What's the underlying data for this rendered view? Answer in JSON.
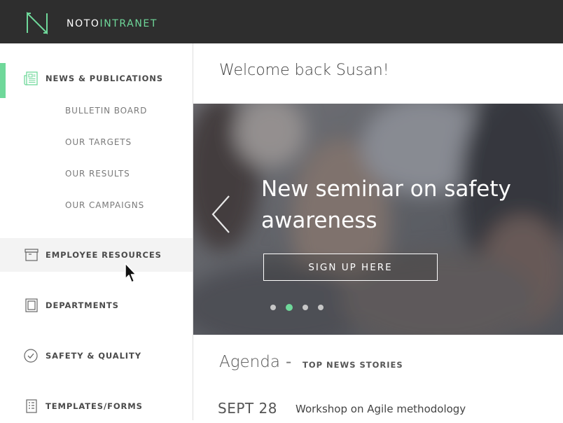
{
  "brand": {
    "name_part1": "NOTO",
    "name_part2": "INTRANET",
    "accent_color": "#6fd89a",
    "bar_color": "#2e2e2e"
  },
  "sidebar": {
    "items": [
      {
        "label": "NEWS & PUBLICATIONS",
        "icon": "newspaper-icon",
        "active": true,
        "subitems": [
          "BULLETIN BOARD",
          "OUR TARGETS",
          "OUR RESULTS",
          "OUR CAMPAIGNS"
        ]
      },
      {
        "label": "EMPLOYEE RESOURCES",
        "icon": "archive-box-icon",
        "hovered": true
      },
      {
        "label": "DEPARTMENTS",
        "icon": "book-icon"
      },
      {
        "label": "SAFETY & QUALITY",
        "icon": "check-circle-icon"
      },
      {
        "label": "TEMPLATES/FORMS",
        "icon": "form-list-icon"
      }
    ]
  },
  "main": {
    "welcome": "Welcome back Susan!",
    "hero": {
      "title": "New seminar on safety awareness",
      "button_label": "SIGN UP HERE",
      "slide_count": 4,
      "active_slide": 2
    },
    "agenda": {
      "title": "Agenda",
      "dash": "-",
      "subtitle": "TOP NEWS STORIES",
      "events": [
        {
          "date": "SEPT 28",
          "title": "Workshop on Agile methodology"
        }
      ]
    }
  }
}
